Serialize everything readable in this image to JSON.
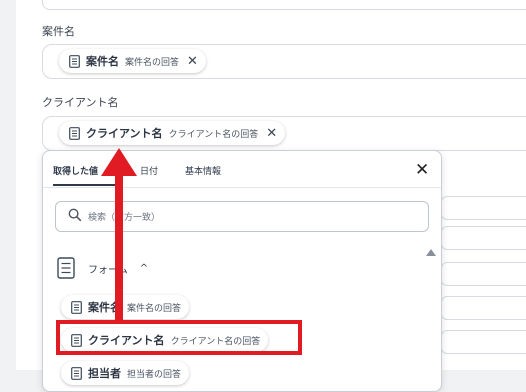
{
  "fields": [
    {
      "label": "案件名",
      "chip": {
        "name": "案件名",
        "desc": "案件名の回答"
      }
    },
    {
      "label": "クライアント名",
      "chip": {
        "name": "クライアント名",
        "desc": "クライアント名の回答"
      }
    }
  ],
  "popup": {
    "tabs": [
      "取得した値",
      "日付",
      "基本情報"
    ],
    "active_tab": 0,
    "close": "✕",
    "search_placeholder": "検索（前方一致）",
    "section": {
      "title": "フォーム",
      "chevron": "^"
    },
    "items": [
      {
        "name": "案件名",
        "desc": "案件名の回答"
      },
      {
        "name": "クライアント名",
        "desc": "クライアント名の回答"
      },
      {
        "name": "担当者",
        "desc": "担当者の回答"
      }
    ]
  },
  "annotation": {
    "color": "#e01b24"
  }
}
